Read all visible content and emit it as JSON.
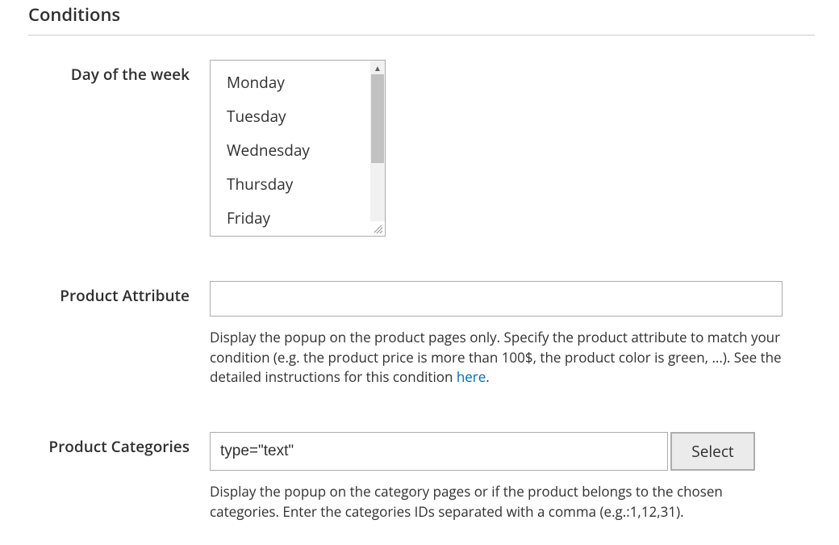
{
  "section": {
    "title": "Conditions"
  },
  "fields": {
    "dayOfWeek": {
      "label": "Day of the week",
      "options": [
        "Monday",
        "Tuesday",
        "Wednesday",
        "Thursday",
        "Friday"
      ]
    },
    "productAttribute": {
      "label": "Product Attribute",
      "value": "",
      "help_prefix": "Display the popup on the product pages only. Specify the product attribute to match your condition (e.g. the product price is more than 100$, the product color is green, ...). See the detailed instructions for this condition ",
      "help_link": "here",
      "help_suffix": "."
    },
    "productCategories": {
      "label": "Product Categories",
      "value": "type=\"text\"",
      "button": "Select",
      "help": "Display the popup on the category pages or if the product belongs to the chosen categories. Enter the categories IDs separated with a comma (e.g.:1,12,31)."
    }
  }
}
